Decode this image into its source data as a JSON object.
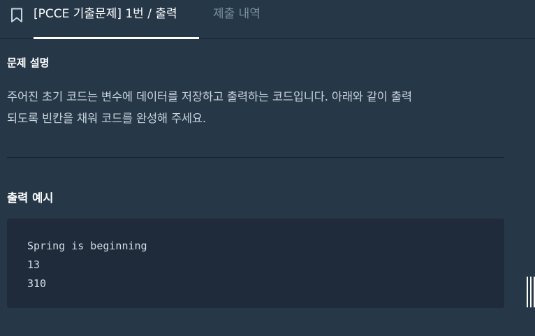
{
  "tabs": {
    "bookmark_icon": "bookmark-icon",
    "active_label": "[PCCE 기출문제] 1번 / 출력",
    "inactive_label": "제출 내역"
  },
  "description": {
    "title": "문제 설명",
    "line1": "주어진 초기 코드는 변수에 데이터를 저장하고 출력하는 코드입니다. 아래와 같이 출력",
    "line2": "되도록 빈칸을 채워 코드를 완성해 주세요."
  },
  "output_example": {
    "title": "출력 예시",
    "lines": [
      "Spring is beginning",
      "13",
      "310"
    ]
  },
  "colors": {
    "background": "#263747",
    "code_background": "#1f2a3a",
    "active_tab": "#ffffff",
    "inactive_tab": "#78909c"
  }
}
